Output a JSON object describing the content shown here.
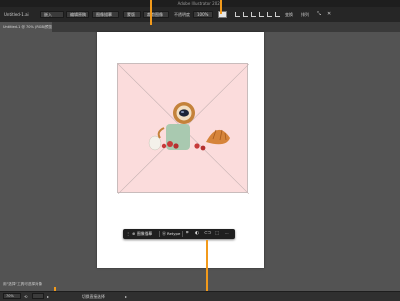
{
  "window": {
    "title": "Adobe Illustrator 2024"
  },
  "control_bar": {
    "selection_label": "Untitled-1.ai",
    "embed_button": "嵌入",
    "edit_original_button": "编辑原稿",
    "image_trace_button": "图像描摹",
    "mask_button": "蒙版",
    "crop_image_button": "裁剪图像",
    "opacity_label": "不透明度",
    "opacity_value": "100%",
    "transform_label": "变换",
    "arrange_label": "排列"
  },
  "document_tab": {
    "label": "Untitled-1 @ 70% (RGB/预览)"
  },
  "contextual_taskbar": {
    "image_trace_label": "图像描摹",
    "retype_label": "Retype",
    "more_label": "⋯"
  },
  "status_bar": {
    "hint": "用\"选择\"工具可选择对象",
    "zoom_value": "70%",
    "tool_name": "切换直接选择"
  },
  "colors": {
    "accent_callout": "#f29a1b",
    "workspace_bg": "#535353",
    "placed_image_bg": "#fbdcdc"
  }
}
